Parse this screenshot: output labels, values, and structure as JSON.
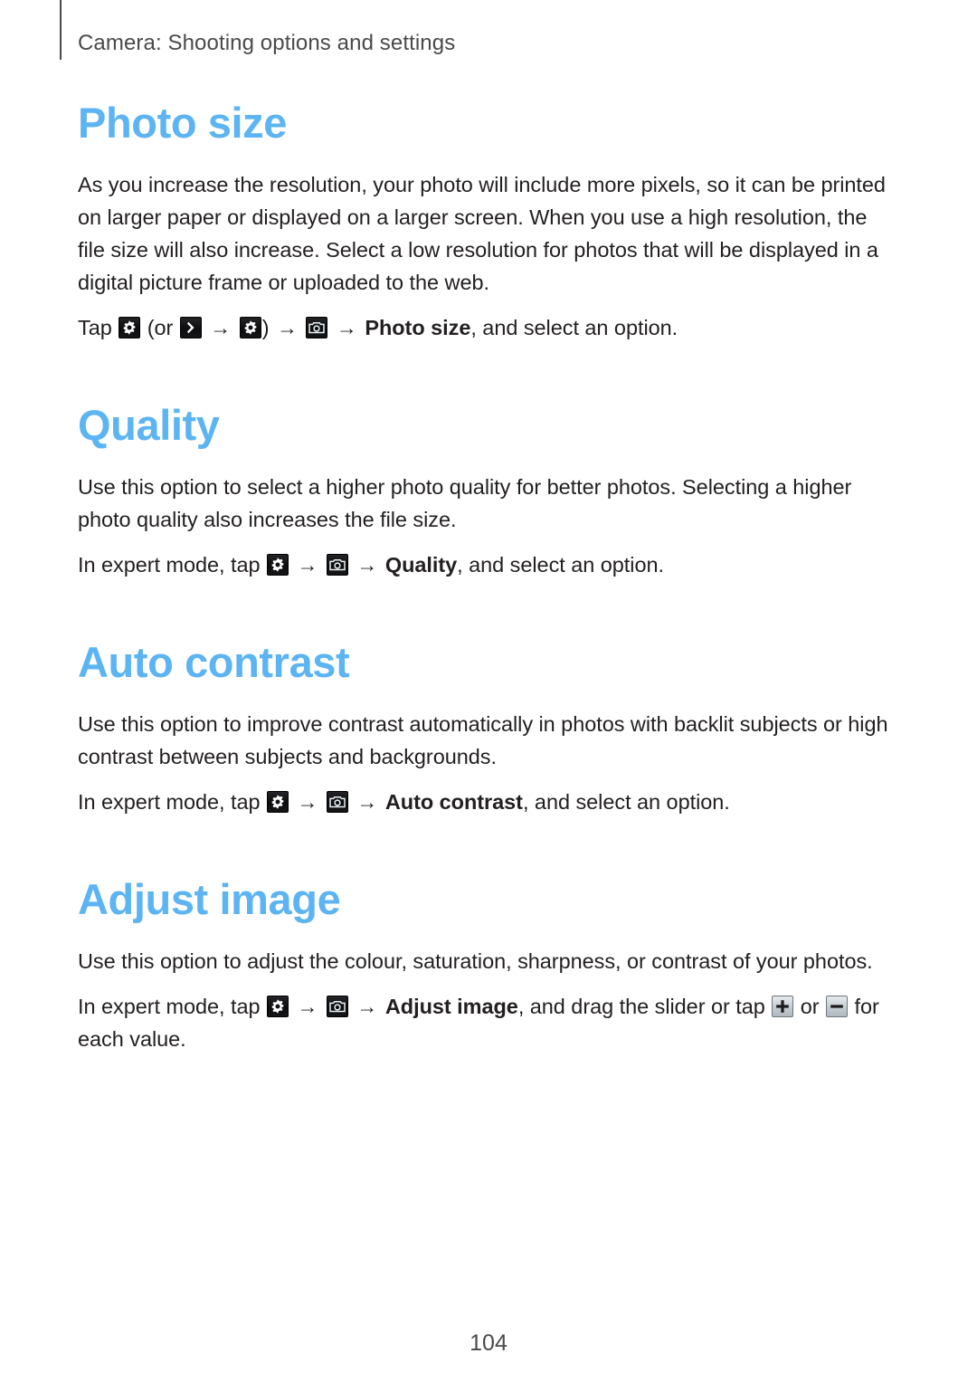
{
  "document": {
    "running_header": "Camera: Shooting options and settings",
    "page_number": "104",
    "heading_color": "#5cb5f2",
    "body_color": "#231f20"
  },
  "icons": {
    "settings": "settings-gear-icon",
    "chevron": "chevron-right-icon",
    "camera": "camera-icon",
    "plus": "plus-icon",
    "minus": "minus-icon"
  },
  "sections": [
    {
      "id": "photo-size",
      "title": "Photo size",
      "body": "As you increase the resolution, your photo will include more pixels, so it can be printed on larger paper or displayed on a larger screen. When you use a high resolution, the file size will also increase. Select a low resolution for photos that will be displayed in a digital picture frame or uploaded to the web.",
      "path": {
        "lead": "Tap",
        "paren_open": "(or",
        "paren_close": ")",
        "arrow": "→",
        "target": "Photo size",
        "tail": ", and select an option."
      }
    },
    {
      "id": "quality",
      "title": "Quality",
      "body": "Use this option to select a higher photo quality for better photos. Selecting a higher photo quality also increases the file size.",
      "path": {
        "lead": "In expert mode, tap",
        "arrow": "→",
        "target": "Quality",
        "tail": ", and select an option."
      }
    },
    {
      "id": "auto-contrast",
      "title": "Auto contrast",
      "body": "Use this option to improve contrast automatically in photos with backlit subjects or high contrast between subjects and backgrounds.",
      "path": {
        "lead": "In expert mode, tap",
        "arrow": "→",
        "target": "Auto contrast",
        "tail": ", and select an option."
      }
    },
    {
      "id": "adjust-image",
      "title": "Adjust image",
      "body": "Use this option to adjust the colour, saturation, sharpness, or contrast of your photos.",
      "path": {
        "lead": "In expert mode, tap",
        "arrow": "→",
        "target": "Adjust image",
        "tail_1": ", and drag the slider or tap",
        "or": "or",
        "tail_2": "for each value."
      }
    }
  ]
}
